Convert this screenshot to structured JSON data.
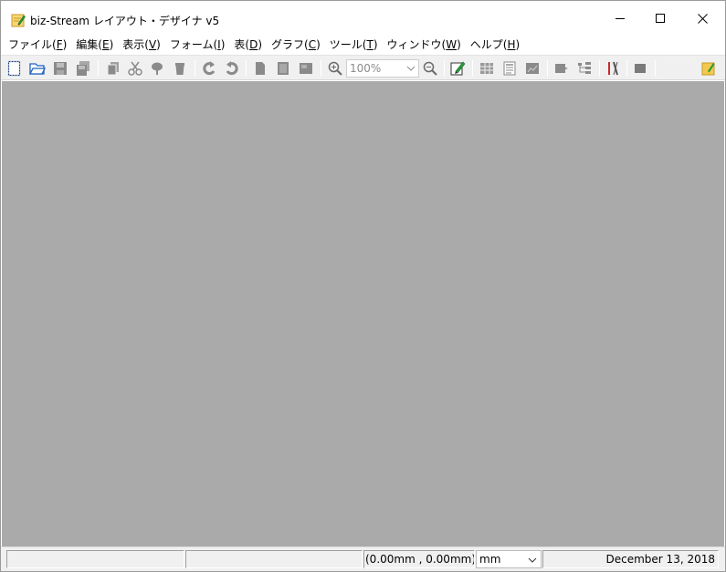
{
  "window": {
    "title": "biz-Stream レイアウト・デザイナ v5",
    "app_icon": "pencil-note-icon",
    "controls": [
      "minimize-icon",
      "maximize-icon",
      "close-icon"
    ]
  },
  "menu": {
    "items": [
      {
        "label": "ファイル(",
        "acc": "F",
        "tail": ")"
      },
      {
        "label": "編集(",
        "acc": "E",
        "tail": ")"
      },
      {
        "label": "表示(",
        "acc": "V",
        "tail": ")"
      },
      {
        "label": "フォーム(",
        "acc": "I",
        "tail": ")"
      },
      {
        "label": "表(",
        "acc": "D",
        "tail": ")"
      },
      {
        "label": "グラフ(",
        "acc": "C",
        "tail": ")"
      },
      {
        "label": "ツール(",
        "acc": "T",
        "tail": ")"
      },
      {
        "label": "ウィンドウ(",
        "acc": "W",
        "tail": ")"
      },
      {
        "label": "ヘルプ(",
        "acc": "H",
        "tail": ")"
      }
    ]
  },
  "toolbar": {
    "zoom_value": "100%",
    "icons": [
      "new-document-icon",
      "open-folder-icon",
      "save-icon",
      "save-all-icon",
      "copy-icon",
      "cut-icon",
      "paste-icon",
      "delete-icon",
      "undo-icon",
      "redo-icon",
      "page-icon",
      "page-setup-icon",
      "page-layout-icon",
      "zoom-in-icon",
      "zoom-out-icon",
      "edit-icon",
      "table-icon",
      "text-block-icon",
      "chart-block-icon",
      "shape-icon",
      "tree-icon",
      "tools-icon",
      "stop-icon",
      "notes-icon"
    ]
  },
  "status": {
    "panel1": "",
    "panel2": "",
    "coordinates": "(0.00mm , 0.00mm)",
    "unit": "mm",
    "date": "December 13, 2018"
  },
  "colors": {
    "workspace": "#aaaaaa",
    "toolbar_bg": "#f0f0f0",
    "icon_gray": "#8a8a8a",
    "icon_blue": "#1f5fbf",
    "icon_green": "#2a9a3a",
    "icon_red": "#cc2a2a",
    "icon_yellow": "#f2c94c"
  }
}
